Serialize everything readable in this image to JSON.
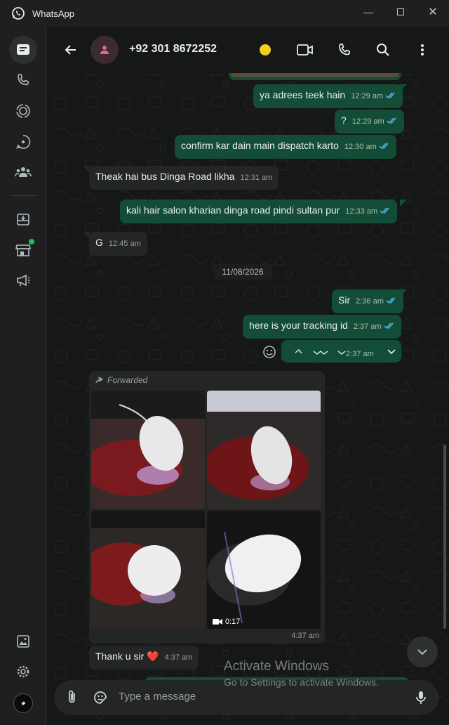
{
  "window": {
    "title": "WhatsApp",
    "logo_icon": "whatsapp-logo-icon",
    "minimize_icon": "minimize-icon",
    "maximize_icon": "maximize-icon",
    "close_icon": "close-icon"
  },
  "rail": {
    "items": [
      {
        "name": "chats",
        "icon": "chats-icon",
        "active": true
      },
      {
        "name": "calls",
        "icon": "phone-icon"
      },
      {
        "name": "status",
        "icon": "status-icon"
      },
      {
        "name": "channels",
        "icon": "channels-icon"
      },
      {
        "name": "communities",
        "icon": "communities-icon"
      },
      {
        "name": "archived",
        "icon": "archive-icon"
      },
      {
        "name": "business-tools",
        "icon": "store-icon",
        "badge": true
      },
      {
        "name": "advertise",
        "icon": "megaphone-icon"
      },
      {
        "name": "media",
        "icon": "media-gallery-icon"
      },
      {
        "name": "settings",
        "icon": "gear-icon"
      },
      {
        "name": "profile",
        "icon": "profile-avatar-icon"
      }
    ]
  },
  "header": {
    "contact_name": "+92 301 8672252",
    "back_icon": "back-arrow-icon",
    "avatar_icon": "person-icon",
    "status_dot_color": "#f4cf1f",
    "video_icon": "video-call-icon",
    "call_icon": "phone-icon",
    "search_icon": "search-icon",
    "menu_icon": "more-vertical-icon"
  },
  "messages": [
    {
      "dir": "out",
      "text": "ya adrees teek hain",
      "time": "12:29 am",
      "read": true
    },
    {
      "dir": "out",
      "text": "?",
      "time": "12:29 am",
      "read": true
    },
    {
      "dir": "out",
      "text": "confirm kar dain main dispatch karto",
      "time": "12:30 am",
      "read": true
    },
    {
      "dir": "in",
      "text": "Theak hai bus Dinga Road likha",
      "time": "12:31 am"
    },
    {
      "dir": "out",
      "text": "kali hair salon kharian dinga road pindi sultan pur",
      "time": "12:33 am",
      "read": true
    },
    {
      "dir": "in",
      "text": "G",
      "time": "12:45 am"
    },
    {
      "dir": "out",
      "text": "Sir",
      "time": "2:36 am",
      "read": true
    },
    {
      "dir": "out",
      "text": "here is your tracking id",
      "time": "2:37 am",
      "read": true
    },
    {
      "dir": "out",
      "text": "",
      "time": "2:37 am",
      "read": false
    },
    {
      "dir": "in",
      "text": "Thank u sir ❤️",
      "time": "4:37 am"
    }
  ],
  "date_divider": "11/08/2026",
  "forwarded": {
    "label": "Forwarded",
    "time": "4:37 am",
    "video_duration": "0:17",
    "photos": [
      "mouse-photo-1",
      "mouse-photo-2",
      "mouse-photo-3",
      "mouse-video-4"
    ]
  },
  "composer": {
    "placeholder": "Type a message",
    "attach_icon": "paperclip-icon",
    "sticker_icon": "sticker-icon",
    "mic_icon": "microphone-icon"
  },
  "overlay": {
    "activate_title": "Activate Windows",
    "activate_sub": "Go to Settings to activate Windows."
  },
  "colors": {
    "outgoing": "#144d37",
    "incoming": "#242626",
    "accent": "#21c063",
    "read_ticks": "#53bdeb"
  }
}
